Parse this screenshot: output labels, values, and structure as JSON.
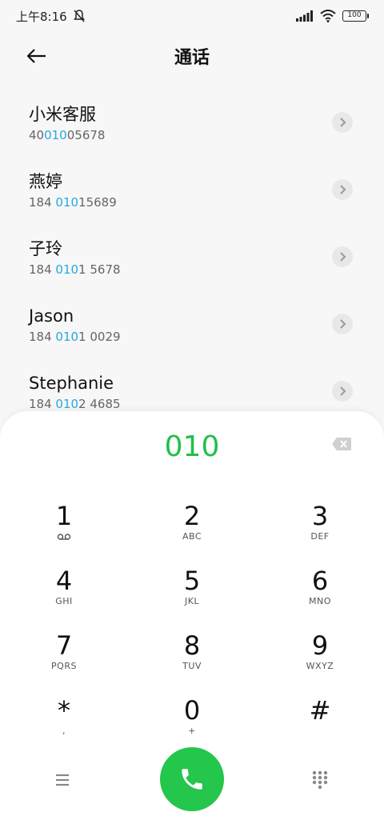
{
  "status": {
    "time": "上午8:16",
    "battery": "100"
  },
  "header": {
    "title": "通话"
  },
  "results": [
    {
      "name": "小米客服",
      "num_pre": "40",
      "num_hl": "010",
      "num_post": "05678"
    },
    {
      "name": "燕婷",
      "num_pre": "184 ",
      "num_hl": "010",
      "num_post": "15689"
    },
    {
      "name": "子玲",
      "num_pre": "184 ",
      "num_hl": "010",
      "num_post": "1 5678"
    },
    {
      "name": "Jason",
      "num_pre": "184 ",
      "num_hl": "010",
      "num_post": "1 0029"
    },
    {
      "name": "Stephanie",
      "num_pre": "184 ",
      "num_hl": "010",
      "num_post": "2 4685"
    }
  ],
  "dialpad": {
    "entry": "010",
    "keys": [
      {
        "digit": "1",
        "letters": ""
      },
      {
        "digit": "2",
        "letters": "ABC"
      },
      {
        "digit": "3",
        "letters": "DEF"
      },
      {
        "digit": "4",
        "letters": "GHI"
      },
      {
        "digit": "5",
        "letters": "JKL"
      },
      {
        "digit": "6",
        "letters": "MNO"
      },
      {
        "digit": "7",
        "letters": "PQRS"
      },
      {
        "digit": "8",
        "letters": "TUV"
      },
      {
        "digit": "9",
        "letters": "WXYZ"
      },
      {
        "digit": "*",
        "letters": ","
      },
      {
        "digit": "0",
        "letters": "+"
      },
      {
        "digit": "#",
        "letters": ""
      }
    ]
  },
  "colors": {
    "accent_green": "#24c64b",
    "highlight_blue": "#24a9e0"
  },
  "icons": {
    "key1_sub": "voicemail-icon",
    "back": "back-arrow-icon",
    "chevron": "chevron-right-icon",
    "delete": "backspace-icon",
    "menu": "menu-icon",
    "call": "phone-icon",
    "keypad_toggle": "dialpad-grid-icon"
  }
}
